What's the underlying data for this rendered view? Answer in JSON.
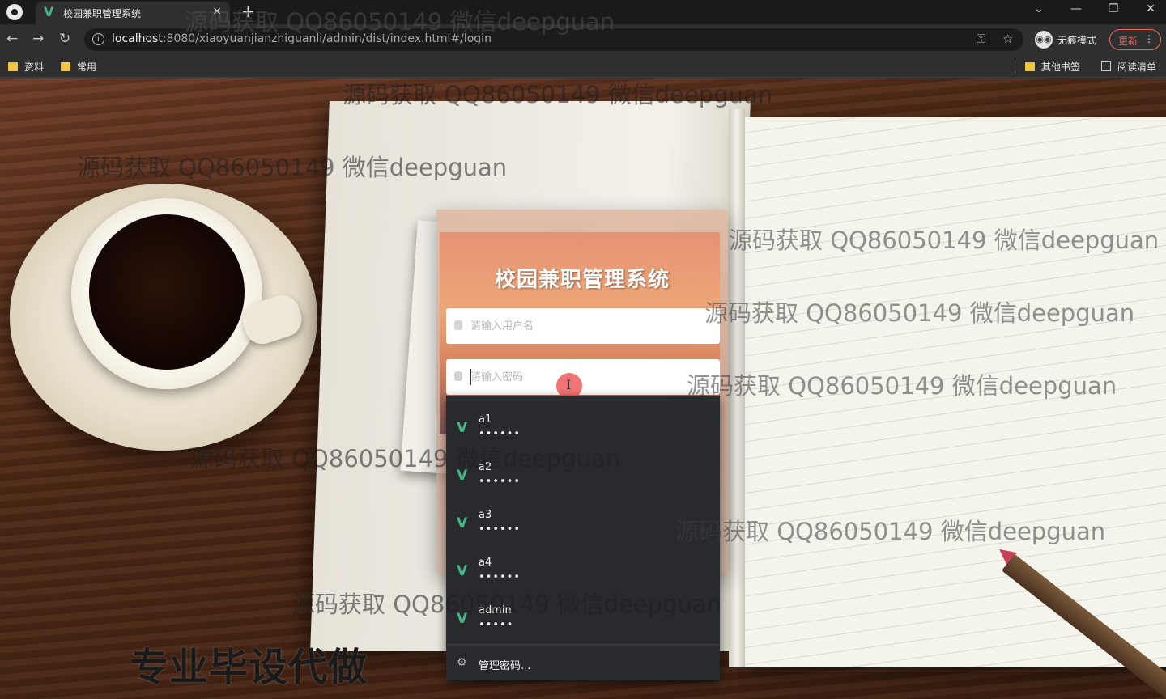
{
  "browser": {
    "tab": {
      "title": "校园兼职管理系统",
      "close": "×"
    },
    "new_tab": "+",
    "window_controls": {
      "chevron": "⌄",
      "minimize": "—",
      "restore": "❐",
      "close": "✕"
    },
    "nav": {
      "back": "←",
      "forward": "→",
      "reload": "↻"
    },
    "url_host": "localhost",
    "url_rest": ":8080/xiaoyuanjianzhiguanli/admin/dist/index.html#/login",
    "key_icon": "⚿",
    "star_icon": "☆",
    "incognito_label": "无痕模式",
    "update_label": "更新",
    "menu_dots": "⋮",
    "bookmarks": [
      {
        "label": "资料",
        "icon": "folder-icon"
      },
      {
        "label": "常用",
        "icon": "folder-icon"
      }
    ],
    "bookmarks_right": [
      {
        "label": "其他书签",
        "icon": "folder-icon"
      },
      {
        "label": "阅读清单",
        "icon": "reader-icon"
      }
    ]
  },
  "login": {
    "title": "校园兼职管理系统",
    "username_placeholder": "请输入用户名",
    "password_placeholder": "请输入密码"
  },
  "autofill": {
    "suggestions": [
      {
        "user": "a1",
        "password": "••••••"
      },
      {
        "user": "a2",
        "password": "••••••"
      },
      {
        "user": "a3",
        "password": "••••••"
      },
      {
        "user": "a4",
        "password": "••••••"
      },
      {
        "user": "admin",
        "password": "•••••"
      }
    ],
    "suggestion_icon": "V",
    "manage_label": "管理密码...",
    "manage_icon": "⚙"
  },
  "promo": "专业毕设代做",
  "watermark_text": "源码获取 QQ86050149 微信deepguan",
  "colors": {
    "vue_green": "#42b883",
    "update_red": "#e8685c",
    "dropdown_bg": "#292a2d"
  }
}
